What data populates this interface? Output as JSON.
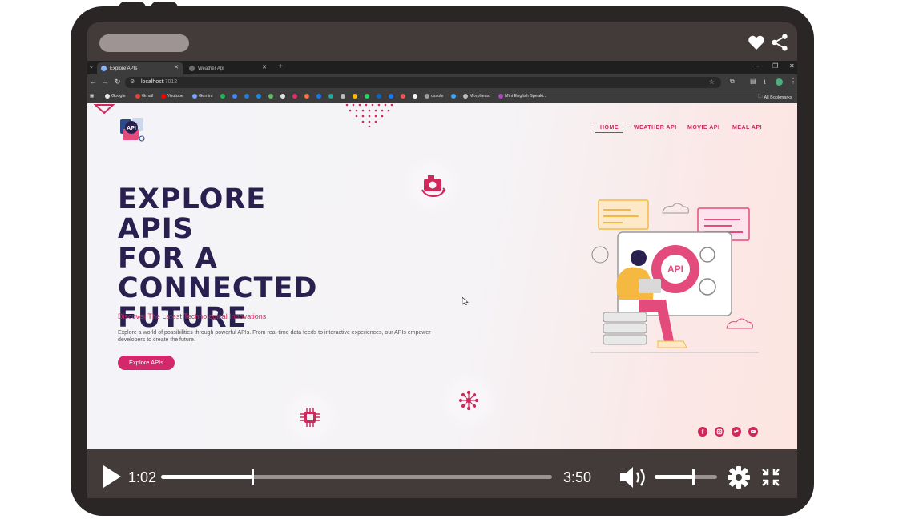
{
  "browser": {
    "tabs": [
      {
        "label": "Explore APIs"
      },
      {
        "label": "Weather Api"
      }
    ],
    "url_host": "localhost",
    "url_port": ":7012",
    "bookmarks": [
      "Google",
      "Gmail",
      "Youtube",
      "Gemini",
      "cssole",
      "Morpheus!",
      "Mini English Speaki...",
      "All Bookmarks"
    ]
  },
  "site": {
    "nav": [
      "HOME",
      "WEATHER API",
      "MOVIE API",
      "MEAL API"
    ],
    "logo_text": "API",
    "hero_title": [
      "EXPLORE APIS",
      "FOR A",
      "CONNECTED",
      "FUTURE"
    ],
    "hero_subtitle": "Discover The Latest Technological Innovations",
    "hero_body": "Explore a world of possibilities through powerful APIs. From real-time data feeds to interactive experiences, our APIs empower developers to create the future.",
    "cta_label": "Explore APIs",
    "illustration_badge": "API",
    "accent_color": "#d0285b",
    "title_color": "#2a2050",
    "social_icons": [
      "facebook-icon",
      "instagram-icon",
      "twitter-icon",
      "youtube-icon"
    ]
  },
  "player": {
    "current_time": "1:02",
    "total_time": "3:50",
    "progress": 0.233,
    "volume": 0.62
  }
}
